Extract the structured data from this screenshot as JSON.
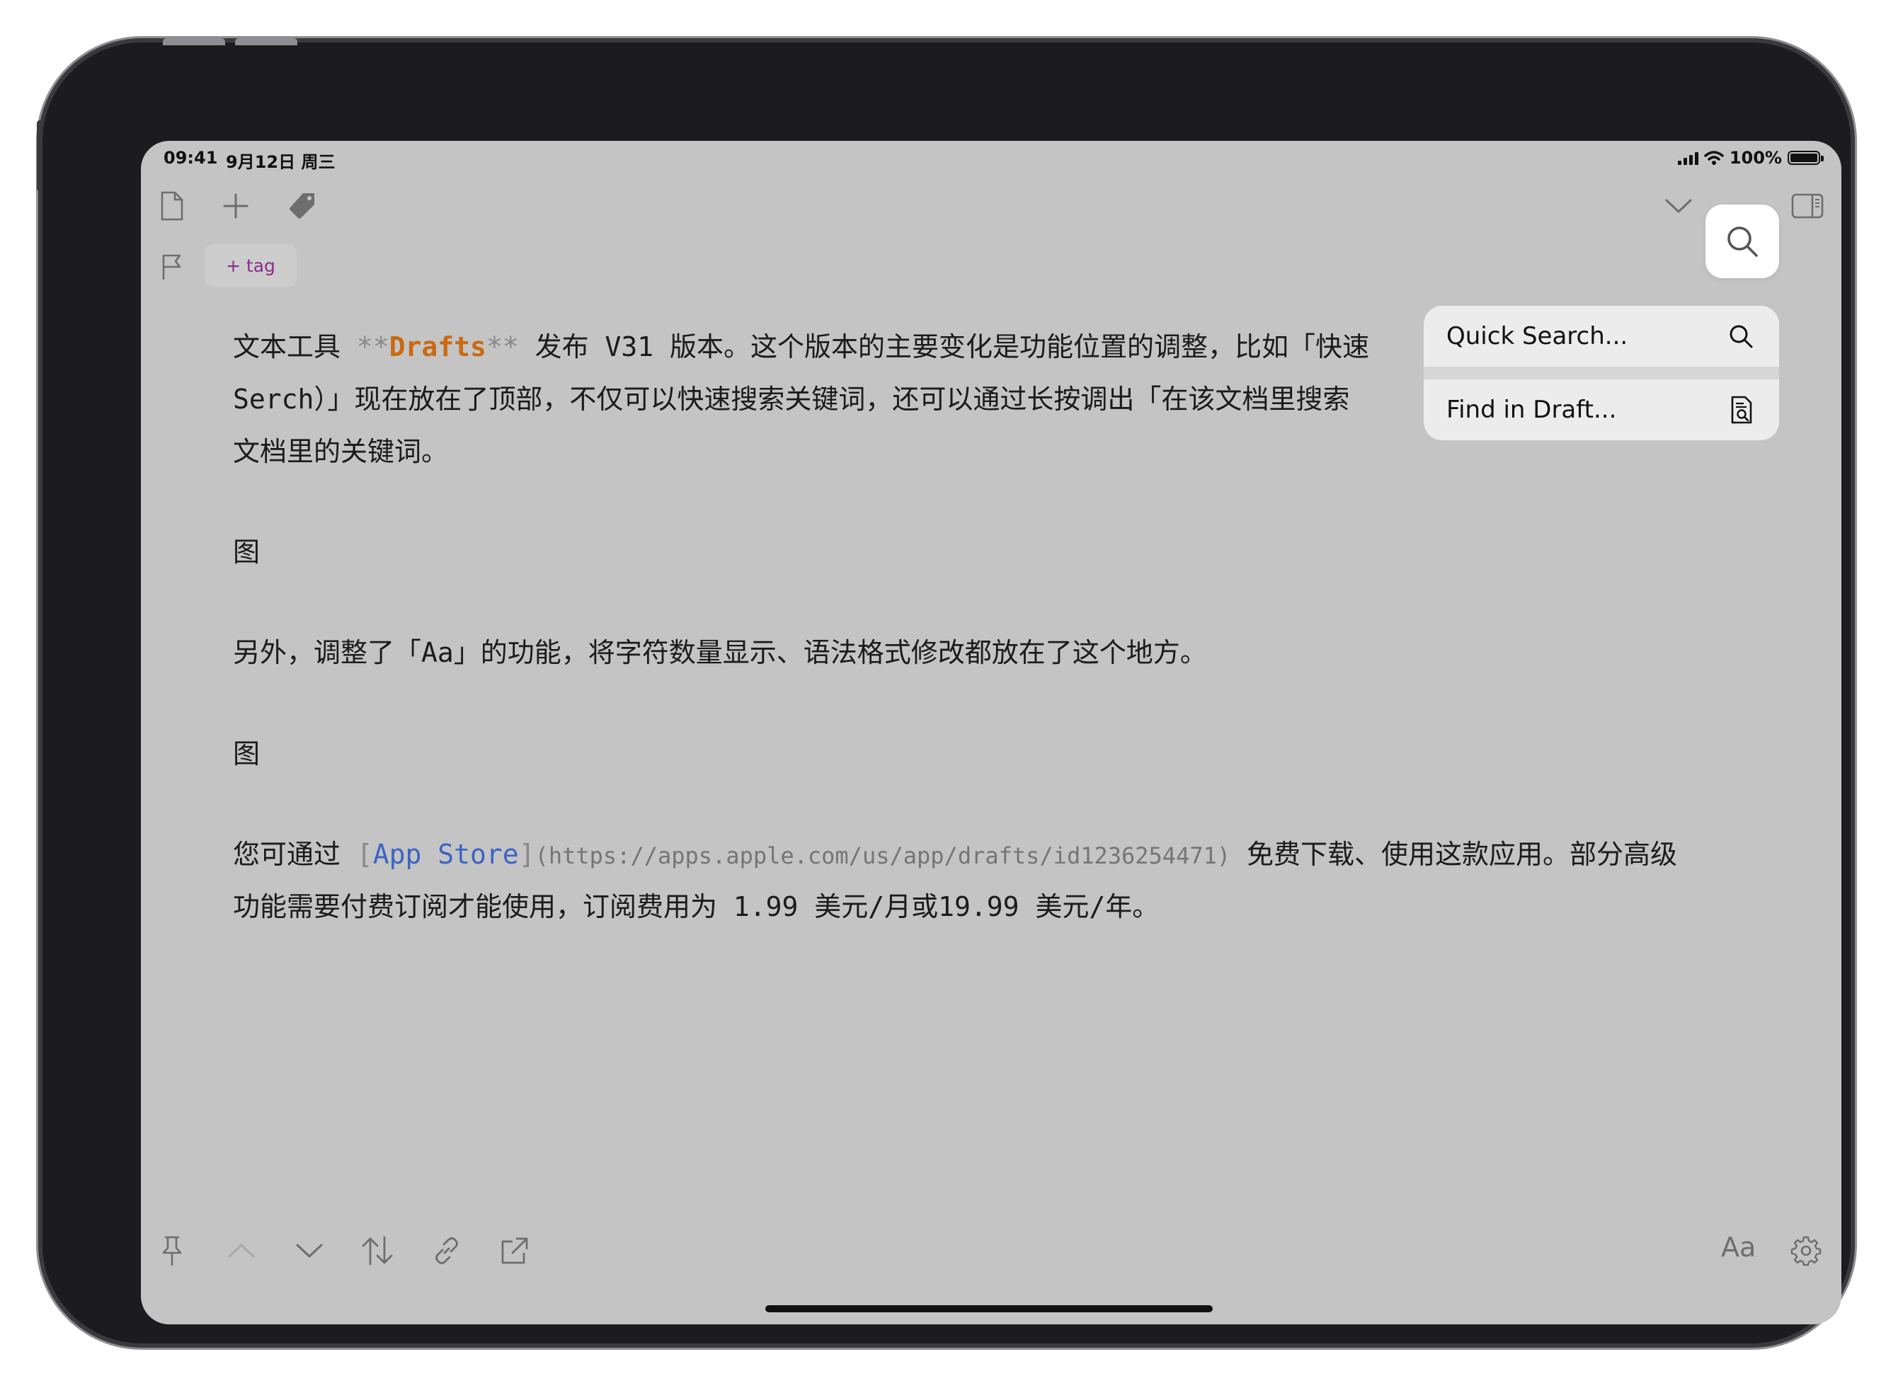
{
  "status_bar": {
    "time": "09:41",
    "date": "9月12日 周三",
    "battery": "100%"
  },
  "toolbar": {
    "new_draft_icon": "document-icon",
    "add_icon": "plus-icon",
    "tag_icon": "tag-icon",
    "flag_icon": "flag-icon",
    "tag_label": "+ tag",
    "collapse_icon": "chevron-down-icon",
    "panel_icon": "sidebar-right-icon",
    "search_icon": "search-icon"
  },
  "search_menu": {
    "quick_search": "Quick Search...",
    "find_in_draft": "Find in Draft..."
  },
  "editor": {
    "p1_line1_a": "文本工具 ",
    "p1_line1_bold_open": "**",
    "p1_line1_bold": "Drafts",
    "p1_line1_bold_close": "**",
    "p1_line1_b": " 发布 V31 版本。这个版本的主要变化是功能位置的调整，比如「快速",
    "p1_line2": "Serch）」现在放在了顶部，不仅可以快速搜索关键词，还可以通过长按调出「在该文档里搜索",
    "p1_line3": "文档里的关键词。",
    "fig1": "图",
    "p2": "另外，调整了「Aa」的功能，将字符数量显示、语法格式修改都放在了这个地方。",
    "fig2": "图",
    "p3_a": "您可通过 ",
    "p3_link_open": "[",
    "p3_link_text": "App Store",
    "p3_link_close": "]",
    "p3_url": "(https://apps.apple.com/us/app/drafts/id1236254471)",
    "p3_b": " 免费下载、使用这款应用。部分高级",
    "p3_line2": "功能需要付费订阅才能使用，订阅费用为 1.99 美元/月或19.99 美元/年。"
  },
  "bottom_toolbar": {
    "pin_icon": "pin-icon",
    "up_icon": "chevron-up-icon",
    "down_icon": "chevron-down-icon",
    "arrange_icon": "arrows-updown-icon",
    "link_icon": "link-icon",
    "share_icon": "share-icon",
    "aa_label": "Aa",
    "settings_icon": "gear-icon"
  },
  "colors": {
    "background": "#c4c4c4",
    "bold_markdown": "#c96a12",
    "link": "#3b64c4",
    "tag": "#8a2d8f"
  }
}
